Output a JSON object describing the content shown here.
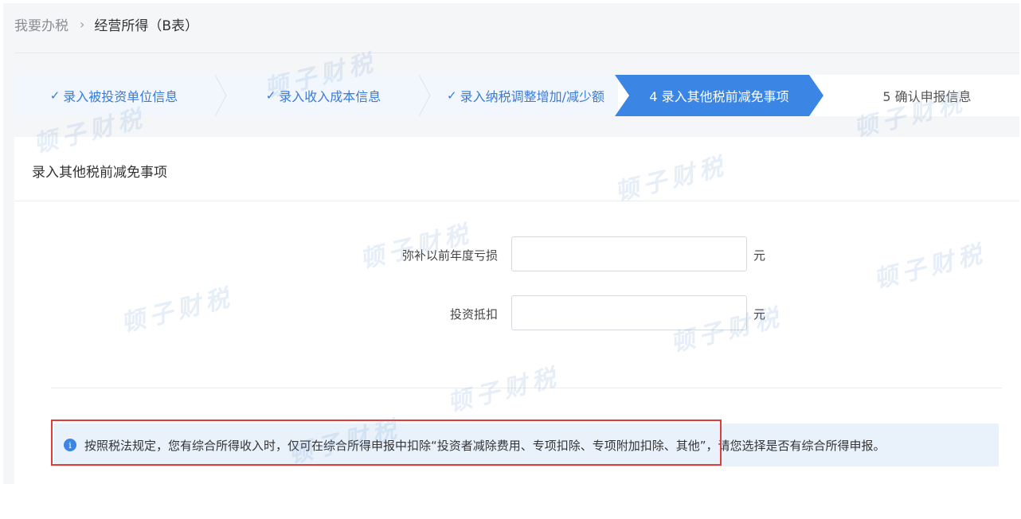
{
  "breadcrumb": {
    "parent": "我要办税",
    "separator": "›",
    "current": "经营所得（B表）"
  },
  "steps": [
    {
      "label": "录入被投资单位信息",
      "status": "done",
      "mark": "✓"
    },
    {
      "label": "录入收入成本信息",
      "status": "done",
      "mark": "✓"
    },
    {
      "label": "录入纳税调整增加/减少额",
      "status": "done",
      "mark": "✓"
    },
    {
      "label": "4 录入其他税前减免事项",
      "status": "active",
      "mark": ""
    },
    {
      "label": "5 确认申报信息",
      "status": "pending",
      "mark": ""
    }
  ],
  "card": {
    "title": "录入其他税前减免事项",
    "fields": [
      {
        "label": "弥补以前年度亏损",
        "value": "",
        "unit": "元"
      },
      {
        "label": "投资抵扣",
        "value": "",
        "unit": "元"
      }
    ],
    "notice": {
      "icon": "i",
      "text": "按照税法规定，您有综合所得收入时，仅可在综合所得申报中扣除“投资者减除费用、专项扣除、专项附加扣除、其他”，请您选择是否有综合所得申报。"
    }
  },
  "watermark": "顿子财税",
  "colors": {
    "accent": "#3b86e5",
    "done_text": "#3a7bd5",
    "highlight": "#e03c3c",
    "notice_bg": "#e9f2fb"
  }
}
